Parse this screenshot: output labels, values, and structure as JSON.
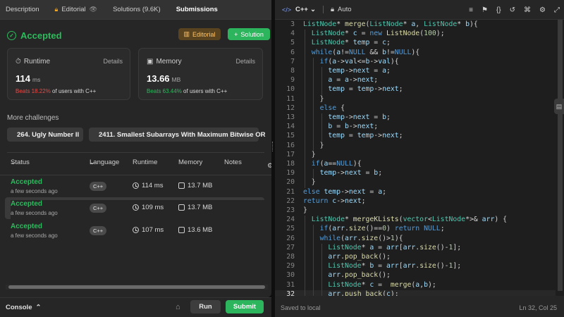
{
  "tabs": [
    {
      "label": "Description"
    },
    {
      "label": "Editorial"
    },
    {
      "label": "Solutions (9.6K)"
    },
    {
      "label": "Submissions"
    }
  ],
  "result": {
    "status": "Accepted",
    "editorial_btn": "Editorial",
    "solution_btn": "Solution"
  },
  "runtime_card": {
    "title": "Runtime",
    "details": "Details",
    "value": "114",
    "unit": "ms",
    "beats_pct": "Beats 18.22%",
    "beats_rest": "of users with C++"
  },
  "memory_card": {
    "title": "Memory",
    "details": "Details",
    "value": "13.66",
    "unit": "MB",
    "beats_pct": "Beats 63.44%",
    "beats_rest": "of users with C++"
  },
  "more_challenges": {
    "heading": "More challenges",
    "items": [
      "264. Ugly Number II",
      "2411. Smallest Subarrays With Maximum Bitwise OR"
    ]
  },
  "table": {
    "headers": [
      "Status",
      "Language",
      "Runtime",
      "Memory",
      "Notes"
    ],
    "rows": [
      {
        "status": "Accepted",
        "time": "a few seconds ago",
        "language": "C++",
        "runtime": "114 ms",
        "memory": "13.7 MB"
      },
      {
        "status": "Accepted",
        "time": "a few seconds ago",
        "language": "C++",
        "runtime": "109 ms",
        "memory": "13.7 MB"
      },
      {
        "status": "Accepted",
        "time": "a few seconds ago",
        "language": "C++",
        "runtime": "107 ms",
        "memory": "13.6 MB"
      }
    ]
  },
  "bottom": {
    "console": "Console",
    "run": "Run",
    "submit": "Submit"
  },
  "editor": {
    "language": "C++",
    "mode": "Auto",
    "saved": "Saved to local",
    "position": "Ln 32, Col 25"
  },
  "colors": {
    "accent_green": "#2cbb5d",
    "beats_red": "#ef4743",
    "editorial_gold": "#ffc56b"
  },
  "code_lines": [
    {
      "n": "3",
      "html": "<span class='ty'>ListNode</span>* <span class='fn'>merge</span>(<span class='ty'>ListNode</span>* <span class='vr'>a</span>, <span class='ty'>ListNode</span>* <span class='vr'>b</span>){"
    },
    {
      "n": "4",
      "html": "<span class='ty'>ListNode</span>* <span class='vr'>c</span> = <span class='kw'>new</span> <span class='fn'>ListNode</span>(<span class='nm'>100</span>);"
    },
    {
      "n": "5",
      "html": "<span class='ty'>ListNode</span>* <span class='vr'>temp</span> = <span class='vr'>c</span>;"
    },
    {
      "n": "6",
      "html": "<span class='kw'>while</span>(<span class='vr'>a</span>!=<span class='kw'>NULL</span> &amp;&amp; <span class='vr'>b</span>!=<span class='kw'>NULL</span>){"
    },
    {
      "n": "7",
      "html": "<span class='kw'>if</span>(<span class='vr'>a</span>-&gt;<span class='vr'>val</span>&lt;=<span class='vr'>b</span>-&gt;<span class='vr'>val</span>){"
    },
    {
      "n": "8",
      "html": "<span class='vr'>temp</span>-&gt;<span class='vr'>next</span> = <span class='vr'>a</span>;"
    },
    {
      "n": "9",
      "html": "<span class='vr'>a</span> = <span class='vr'>a</span>-&gt;<span class='vr'>next</span>;"
    },
    {
      "n": "10",
      "html": "<span class='vr'>temp</span> = <span class='vr'>temp</span>-&gt;<span class='vr'>next</span>;"
    },
    {
      "n": "11",
      "html": "}"
    },
    {
      "n": "12",
      "html": "<span class='kw'>else</span> {"
    },
    {
      "n": "13",
      "html": "<span class='vr'>temp</span>-&gt;<span class='vr'>next</span> = <span class='vr'>b</span>;"
    },
    {
      "n": "14",
      "html": "<span class='vr'>b</span> = <span class='vr'>b</span>-&gt;<span class='vr'>next</span>;"
    },
    {
      "n": "15",
      "html": "<span class='vr'>temp</span> = <span class='vr'>temp</span>-&gt;<span class='vr'>next</span>;"
    },
    {
      "n": "16",
      "html": "}"
    },
    {
      "n": "17",
      "html": "}"
    },
    {
      "n": "18",
      "html": "<span class='kw'>if</span>(<span class='vr'>a</span>==<span class='kw'>NULL</span>){"
    },
    {
      "n": "19",
      "html": "<span class='vr'>temp</span>-&gt;<span class='vr'>next</span> = <span class='vr'>b</span>;"
    },
    {
      "n": "20",
      "html": "}"
    },
    {
      "n": "21",
      "html": "<span class='kw'>else</span> <span class='vr'>temp</span>-&gt;<span class='vr'>next</span> = <span class='vr'>a</span>;"
    },
    {
      "n": "22",
      "html": "<span class='kw'>return</span> <span class='vr'>c</span>-&gt;<span class='vr'>next</span>;"
    },
    {
      "n": "23",
      "html": "}"
    },
    {
      "n": "24",
      "html": "<span class='ty'>ListNode</span>* <span class='fn'>mergeKLists</span>(<span class='ty'>vector</span>&lt;<span class='ty'>ListNode</span>*&gt;&amp; <span class='vr'>arr</span>) {"
    },
    {
      "n": "25",
      "html": "<span class='kw'>if</span>(<span class='vr'>arr</span>.<span class='fn'>size</span>()==<span class='nm'>0</span>) <span class='kw'>return</span> <span class='kw'>NULL</span>;"
    },
    {
      "n": "26",
      "html": "<span class='kw'>while</span>(<span class='vr'>arr</span>.<span class='fn'>size</span>()&gt;<span class='nm'>1</span>){"
    },
    {
      "n": "27",
      "html": "<span class='ty'>ListNode</span>* <span class='vr'>a</span> = <span class='vr'>arr</span>[<span class='vr'>arr</span>.<span class='fn'>size</span>()-<span class='nm'>1</span>];"
    },
    {
      "n": "28",
      "html": "<span class='vr'>arr</span>.<span class='fn'>pop_back</span>();"
    },
    {
      "n": "29",
      "html": "<span class='ty'>ListNode</span>* <span class='vr'>b</span> = <span class='vr'>arr</span>[<span class='vr'>arr</span>.<span class='fn'>size</span>()-<span class='nm'>1</span>];"
    },
    {
      "n": "30",
      "html": "<span class='vr'>arr</span>.<span class='fn'>pop_back</span>();"
    },
    {
      "n": "31",
      "html": "<span class='ty'>ListNode</span>* <span class='vr'>c</span> =  <span class='fn'>merge</span>(<span class='vr'>a</span>,<span class='vr'>b</span>);"
    },
    {
      "n": "32",
      "html": "<span class='vr'>arr</span>.<span class='fn'>push_back</span>(<span class='vr'>c</span>);"
    }
  ]
}
